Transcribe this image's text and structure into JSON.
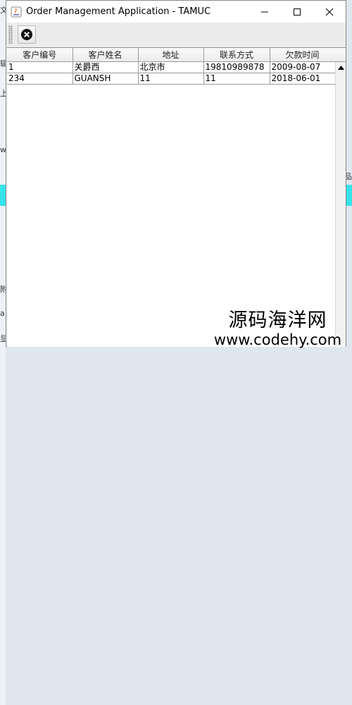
{
  "window": {
    "title": "Order Management Application - TAMUC"
  },
  "titlebar_buttons": {
    "minimize_glyph": "—",
    "maximize_glyph": "☐",
    "close_glyph": "✕"
  },
  "toolbar": {
    "close_icon": "close-circle-icon"
  },
  "table": {
    "headers": [
      "客户编号",
      "客户姓名",
      "地址",
      "联系方式",
      "欠款时间"
    ],
    "rows": [
      [
        "1",
        "关爵西",
        "北京市",
        "19810989878",
        "2009-08-07"
      ],
      [
        "234",
        "GUANSH",
        "11",
        "11",
        "2018-06-01"
      ]
    ]
  },
  "watermark": {
    "line1": "源码海洋网",
    "line2": "www.codehy.com"
  },
  "background_fragments": {
    "left_chars": [
      "文",
      "辑",
      "上",
      "w",
      "附",
      "a",
      "显"
    ],
    "right_chars": [
      "品"
    ]
  }
}
